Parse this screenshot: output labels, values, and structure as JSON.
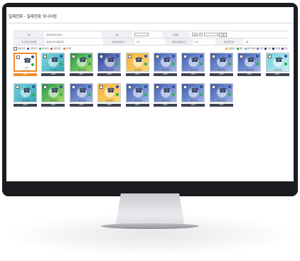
{
  "page": {
    "title": "일제전화 - 일제전화 모니터링"
  },
  "filters": {
    "row1": [
      {
        "label": "구분",
        "value": "총회/내 입원 전화/전"
      },
      {
        "label": "번호",
        "value": ""
      },
      {
        "label": "검색필드",
        "value": "선택",
        "extra": "검색필드",
        "extra2": "검색"
      }
    ],
    "row2": [
      {
        "label": "회 선번호 관리방법",
        "value": "회선번 이전 대체 회원"
      },
      {
        "label": "현재 통화중인 건",
        "value": "1건"
      },
      {
        "label": "현재의 통화중인 건",
        "value": "0건"
      },
      {
        "label": "통화 완료횟수",
        "value": "1회"
      }
    ]
  },
  "toolbar": {
    "items": [
      "전체 선택",
      "단일선택",
      "통화시작",
      "통화 종료",
      "초기화"
    ],
    "legend": [
      {
        "label": "통화대기",
        "color": "#f0b030"
      },
      {
        "label": "통화",
        "color": "#2fae4a"
      },
      {
        "label": "장기미사용",
        "color": "#60c0d0"
      },
      {
        "label": "연결",
        "color": "#6a7cc8"
      },
      {
        "label": "부재",
        "color": "#3a4a9a"
      },
      {
        "label": "미사용",
        "color": "#2a3a7a"
      },
      {
        "label": "종료",
        "color": "#8a3ab0"
      }
    ]
  },
  "cards": [
    {
      "name": "이동국번호",
      "number": "2805",
      "grad": [
        "#ffffff",
        "#ffffff"
      ],
      "selected": true,
      "state": "대기"
    },
    {
      "name": "이동국번호",
      "number": "2806",
      "grad": [
        "#7fd6e0",
        "#3aa6b8"
      ]
    },
    {
      "name": "이동국번호",
      "number": "2807",
      "grad": [
        "#1f9a4a",
        "#a6d86a"
      ]
    },
    {
      "name": "이동국번호",
      "number": "2808",
      "grad": [
        "#2e3f8f",
        "#8fa2de"
      ]
    },
    {
      "name": "이동국번호",
      "number": "2821",
      "grad": [
        "#f2b336",
        "#f6d77a"
      ]
    },
    {
      "name": "이동국번호",
      "number": "2828",
      "grad": [
        "#3d5db0",
        "#9fb4e8"
      ]
    },
    {
      "name": "이동국번호",
      "number": "2831",
      "grad": [
        "#3d5db0",
        "#9fb4e8"
      ]
    },
    {
      "name": "이동국번호",
      "number": "2838",
      "grad": [
        "#3d5db0",
        "#9fb4e8"
      ]
    },
    {
      "name": "이동국번호",
      "number": "2839",
      "grad": [
        "#3d5db0",
        "#9fb4e8"
      ]
    },
    {
      "name": "이동국번호",
      "number": "9832",
      "grad": [
        "#6fd0de",
        "#c8eef2"
      ]
    },
    {
      "name": "이동국번호",
      "number": "2840",
      "grad": [
        "#6fd0de",
        "#3aa6b8"
      ]
    },
    {
      "name": "이동국번호",
      "number": "2841",
      "grad": [
        "#1f9a4a",
        "#a6d86a"
      ]
    },
    {
      "name": "이동국번호",
      "number": "2848",
      "grad": [
        "#3d5db0",
        "#9fb4e8"
      ]
    },
    {
      "name": "이동국번호",
      "number": "2849",
      "grad": [
        "#f2b336",
        "#f6d77a"
      ]
    },
    {
      "name": "이동국번호",
      "number": "2813",
      "grad": [
        "#3d5db0",
        "#9fb4e8"
      ]
    },
    {
      "name": "이동국번호",
      "number": "2814",
      "grad": [
        "#3d5db0",
        "#9fb4e8"
      ]
    },
    {
      "name": "이동국번호",
      "number": "2815",
      "grad": [
        "#3d5db0",
        "#9fb4e8"
      ]
    },
    {
      "name": "이동국번호",
      "number": "2816",
      "grad": [
        "#3d5db0",
        "#9fb4e8"
      ]
    }
  ]
}
